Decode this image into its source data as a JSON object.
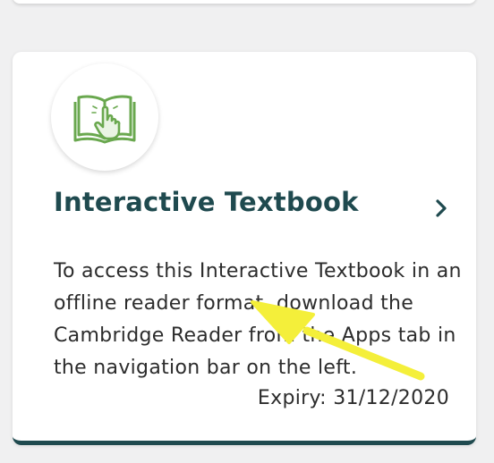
{
  "card": {
    "title": "Interactive Textbook",
    "description": "To access this Interactive Textbook in an offline reader format, download the Cambridge Reader from the Apps tab in the navigation bar on the left.",
    "expiry": "Expiry: 31/12/2020",
    "icon": "book-pointer-icon",
    "action_icon": "chevron-right-icon"
  },
  "colors": {
    "title": "#1f4a4f",
    "accent_bar": "#1f4a4f",
    "icon_green": "#6aa84f",
    "annotation": "#f4ef3a"
  }
}
